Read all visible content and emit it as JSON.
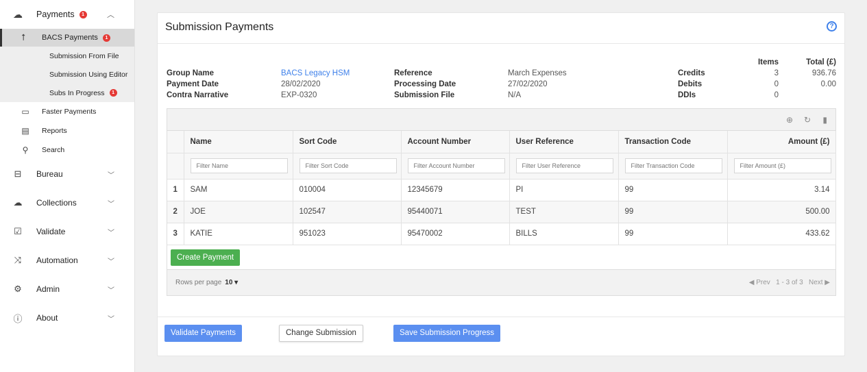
{
  "sidebar": {
    "payments": {
      "label": "Payments",
      "badge": "1",
      "icon": "cloud-upload-icon"
    },
    "bacs": {
      "label": "BACS Payments",
      "badge": "1",
      "icon": "upload-arrow-icon"
    },
    "bacs_sub": [
      {
        "label": "Submission From File"
      },
      {
        "label": "Submission Using Editor"
      },
      {
        "label": "Subs In Progress",
        "badge": "1"
      }
    ],
    "payment_items": [
      {
        "label": "Faster Payments",
        "icon": "credit-card-icon"
      },
      {
        "label": "Reports",
        "icon": "report-icon"
      },
      {
        "label": "Search",
        "icon": "search-icon"
      }
    ],
    "main_items": [
      {
        "label": "Bureau",
        "icon": "bureau-icon"
      },
      {
        "label": "Collections",
        "icon": "cloud-download-icon"
      },
      {
        "label": "Validate",
        "icon": "check-icon"
      },
      {
        "label": "Automation",
        "icon": "shuffle-icon"
      },
      {
        "label": "Admin",
        "icon": "gear-icon"
      },
      {
        "label": "About",
        "icon": "info-icon"
      }
    ]
  },
  "card": {
    "title": "Submission Payments",
    "help_glyph": "?"
  },
  "info": {
    "group_name_label": "Group Name",
    "group_name": "BACS Legacy HSM",
    "payment_date_label": "Payment Date",
    "payment_date": "28/02/2020",
    "contra_label": "Contra Narrative",
    "contra": "EXP-0320",
    "reference_label": "Reference",
    "reference": "March Expenses",
    "processing_date_label": "Processing Date",
    "processing_date": "27/02/2020",
    "submission_file_label": "Submission File",
    "submission_file": "N/A",
    "items_header": "Items",
    "total_header": "Total (£)",
    "credits_label": "Credits",
    "credits_items": "3",
    "credits_total": "936.76",
    "debits_label": "Debits",
    "debits_items": "0",
    "debits_total": "0.00",
    "ddis_label": "DDIs",
    "ddis_items": "0"
  },
  "table": {
    "columns": [
      "Name",
      "Sort Code",
      "Account Number",
      "User Reference",
      "Transaction Code",
      "Amount (£)"
    ],
    "filters": [
      "Filter Name",
      "Filter Sort Code",
      "Filter Account Number",
      "Filter User Reference",
      "Filter Transaction Code",
      "Filter Amount (£)"
    ],
    "rows": [
      {
        "idx": "1",
        "name": "SAM",
        "sort": "010004",
        "account": "12345679",
        "ref": "PI",
        "code": "99",
        "amount": "3.14"
      },
      {
        "idx": "2",
        "name": "JOE",
        "sort": "102547",
        "account": "95440071",
        "ref": "TEST",
        "code": "99",
        "amount": "500.00"
      },
      {
        "idx": "3",
        "name": "KATIE",
        "sort": "951023",
        "account": "95470002",
        "ref": "BILLS",
        "code": "99",
        "amount": "433.62"
      }
    ],
    "create_label": "Create Payment",
    "rows_per_page_label": "Rows per page",
    "rows_per_page": "10 ▾",
    "prev": "◀ Prev",
    "range": "1 - 3 of 3",
    "next": "Next ▶"
  },
  "actions": {
    "validate": "Validate Payments",
    "change": "Change Submission",
    "save": "Save Submission Progress"
  },
  "colors": {
    "accent": "#3e80ea",
    "green": "#4caf50",
    "badge": "#e53935"
  }
}
